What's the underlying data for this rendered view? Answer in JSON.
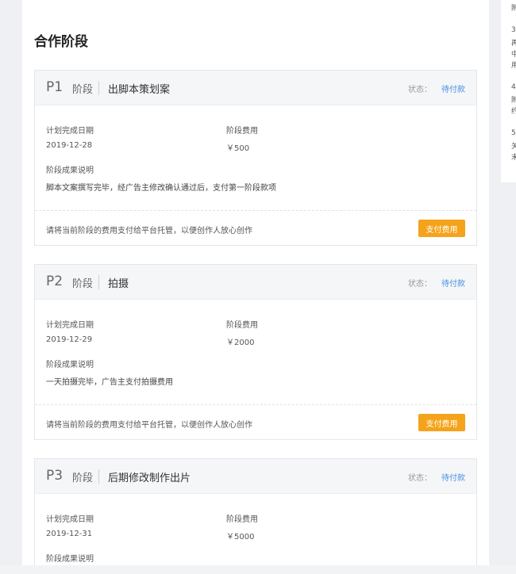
{
  "section": {
    "title": "合作阶段"
  },
  "phases": [
    {
      "code": "P1",
      "phase_word": "阶段",
      "name": "出脚本策划案",
      "status_label": "状态：",
      "status_value": "待付款",
      "due_label": "计划完成日期",
      "due_value": "2019-12-28",
      "fee_label": "阶段费用",
      "fee_value": "￥500",
      "result_label": "阶段成果说明",
      "result_value": "脚本文案撰写完毕，经广告主修改确认通过后，支付第一阶段款项",
      "footer_note": "请将当前阶段的费用支付给平台托管，以便创作人放心创作",
      "pay_button": "支付费用"
    },
    {
      "code": "P2",
      "phase_word": "阶段",
      "name": "拍摄",
      "status_label": "状态：",
      "status_value": "待付款",
      "due_label": "计划完成日期",
      "due_value": "2019-12-29",
      "fee_label": "阶段费用",
      "fee_value": "￥2000",
      "result_label": "阶段成果说明",
      "result_value": "一天拍摄完毕，广告主支付拍摄费用",
      "footer_note": "请将当前阶段的费用支付给平台托管，以便创作人放心创作",
      "pay_button": "支付费用"
    },
    {
      "code": "P3",
      "phase_word": "阶段",
      "name": "后期修改制作出片",
      "status_label": "状态：",
      "status_value": "待付款",
      "due_label": "计划完成日期",
      "due_value": "2019-12-31",
      "fee_label": "阶段费用",
      "fee_value": "￥5000",
      "result_label": "阶段成果说明"
    }
  ],
  "side_panel": {
    "lines": [
      "附",
      "3",
      "再",
      "中",
      "用",
      "4",
      "附",
      "约",
      "5",
      "关",
      "末"
    ]
  },
  "colors": {
    "accent_blue": "#4a90e2",
    "pay_orange": "#f5a31a",
    "header_bg": "#f5f6f8"
  }
}
